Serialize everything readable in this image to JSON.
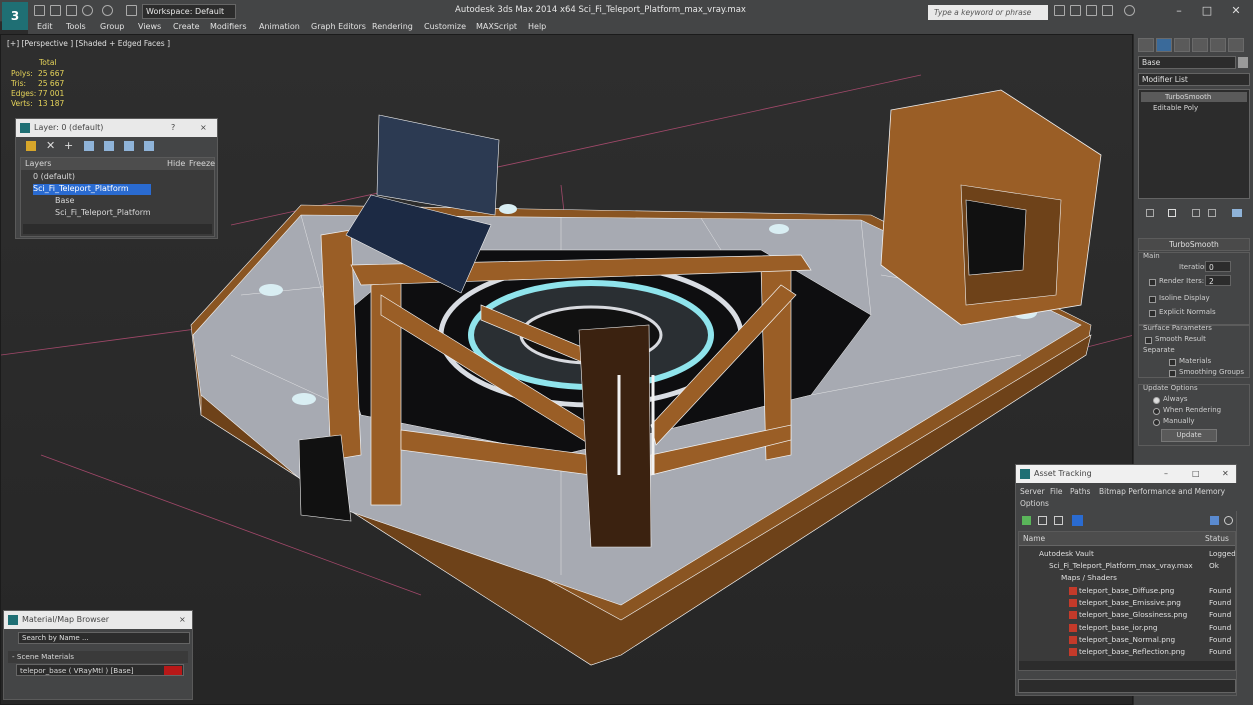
{
  "app": {
    "logo_text": "3",
    "title": "Autodesk 3ds Max  2014 x64     Sci_Fi_Teleport_Platform_max_vray.max",
    "workspace": "Workspace: Default",
    "search_placeholder": "Type a keyword or phrase"
  },
  "menu": [
    "Edit",
    "Tools",
    "Group",
    "Views",
    "Create",
    "Modifiers",
    "Animation",
    "Graph Editors",
    "Rendering",
    "Customize",
    "MAXScript",
    "Help"
  ],
  "viewport": {
    "label": "[+] [Perspective ] [Shaded + Edged Faces ]",
    "stats_header": "Total",
    "stats": [
      {
        "label": "Polys:",
        "value": "25 667"
      },
      {
        "label": "Tris:",
        "value": "25 667"
      },
      {
        "label": "Edges:",
        "value": "77 001"
      },
      {
        "label": "Verts:",
        "value": "13 187"
      }
    ]
  },
  "layer_panel": {
    "title": "Layer: 0 (default)",
    "help": "?",
    "close": "×",
    "columns": [
      "Layers",
      "Hide",
      "Freeze"
    ],
    "rows": [
      {
        "name": "0 (default)",
        "selected": false
      },
      {
        "name": "Sci_Fi_Teleport_Platform",
        "selected": true
      },
      {
        "name": "Base",
        "selected": false
      },
      {
        "name": "Sci_Fi_Teleport_Platform",
        "selected": false
      }
    ]
  },
  "material_browser": {
    "title": "Material/Map Browser",
    "close": "×",
    "search_placeholder": "Search by Name ...",
    "section": "- Scene Materials",
    "material": "telepor_base  ( VRayMtl ) [Base]"
  },
  "command_panel": {
    "object_name": "Base",
    "modifier_list": "Modifier List",
    "stack": [
      "TurboSmooth",
      "Editable Poly"
    ],
    "rollout_title": "TurboSmooth",
    "main_label": "Main",
    "iterations_label": "Iterations:",
    "iterations_value": "0",
    "render_iters_label": "Render Iters:",
    "render_iters_value": "2",
    "isoline_display": "Isoline Display",
    "explicit_normals": "Explicit Normals",
    "surface_params": "Surface Parameters",
    "smooth_result": "Smooth Result",
    "separate": "Separate",
    "materials": "Materials",
    "smoothing_groups": "Smoothing Groups",
    "update_options": "Update Options",
    "always": "Always",
    "when_rendering": "When Rendering",
    "manually": "Manually",
    "update_button": "Update"
  },
  "asset_tracking": {
    "title": "Asset Tracking",
    "menu": [
      "Server",
      "File",
      "Paths",
      "Bitmap Performance and Memory",
      "Options"
    ],
    "columns": [
      "Name",
      "Status"
    ],
    "rows": [
      {
        "name": "Autodesk Vault",
        "status": "Logged O"
      },
      {
        "name": "Sci_Fi_Teleport_Platform_max_vray.max",
        "status": "Ok"
      },
      {
        "name": "Maps / Shaders",
        "status": ""
      },
      {
        "name": "teleport_base_Diffuse.png",
        "status": "Found"
      },
      {
        "name": "teleport_base_Emissive.png",
        "status": "Found"
      },
      {
        "name": "teleport_base_Glossiness.png",
        "status": "Found"
      },
      {
        "name": "teleport_base_ior.png",
        "status": "Found"
      },
      {
        "name": "teleport_base_Normal.png",
        "status": "Found"
      },
      {
        "name": "teleport_base_Reflection.png",
        "status": "Found"
      }
    ]
  },
  "colors": {
    "wood": "#9a5e26",
    "metal": "#a3a6ad",
    "wire": "#f2f2f2",
    "glow": "#7fe0e8",
    "selection": "#2a6bd1"
  }
}
